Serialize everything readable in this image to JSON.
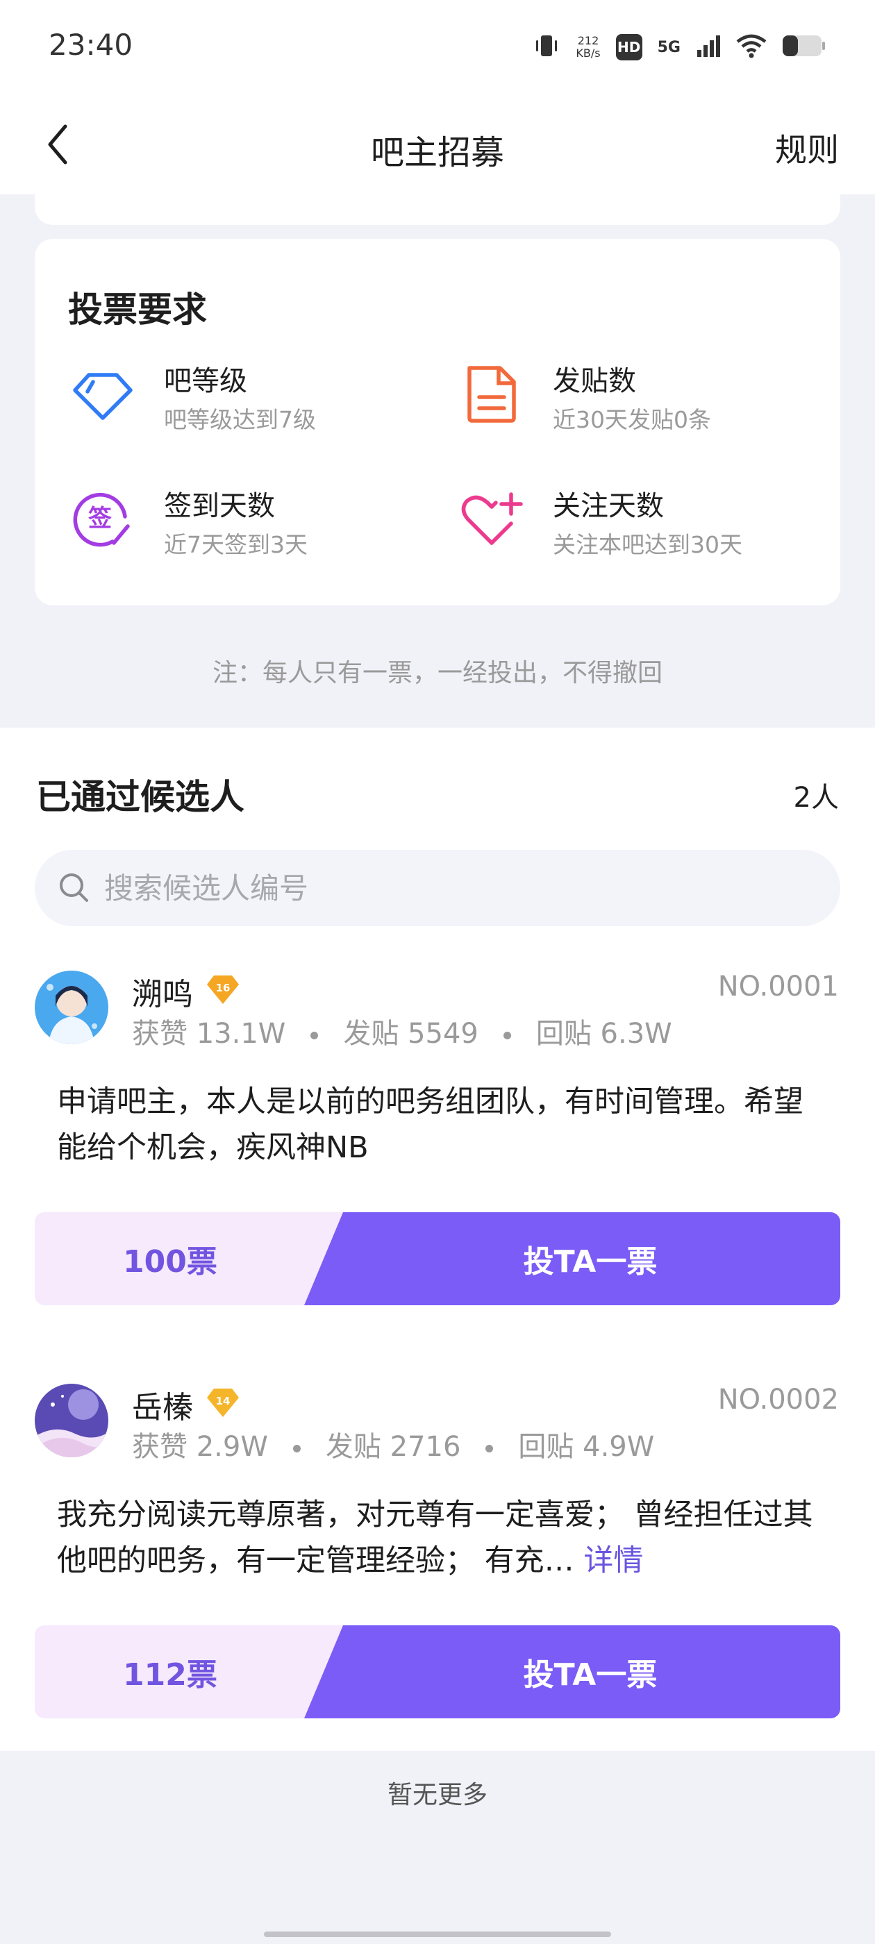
{
  "status_bar": {
    "time": "23:40",
    "net_speed_value": "212",
    "net_speed_unit": "KB/s",
    "hd_label": "HD",
    "network_label": "5G",
    "icons": [
      "vibrate-icon",
      "wifi-icon",
      "battery-icon"
    ]
  },
  "nav": {
    "title": "吧主招募",
    "rules_label": "规则",
    "back_icon": "chevron-left-icon"
  },
  "requirements": {
    "title": "投票要求",
    "items": [
      {
        "name": "吧等级",
        "desc": "吧等级达到7级",
        "icon": "diamond-icon",
        "color": "#2f7cf6"
      },
      {
        "name": "发贴数",
        "desc": "近30天发贴0条",
        "icon": "document-icon",
        "color": "#f26a3c"
      },
      {
        "name": "签到天数",
        "desc": "近7天签到3天",
        "icon": "sign-in-icon",
        "color": "#a33ce3"
      },
      {
        "name": "关注天数",
        "desc": "关注本吧达到30天",
        "icon": "heart-plus-icon",
        "color": "#ec3b8e"
      }
    ],
    "note": "注：每人只有一票，一经投出，不得撤回"
  },
  "candidates": {
    "heading": "已通过候选人",
    "count": "2人",
    "search_placeholder": "搜索候选人编号",
    "list": [
      {
        "name": "溯鸣",
        "level": "16",
        "number": "NO.0001",
        "likes": "获赞 13.1W",
        "posts": "发贴 5549",
        "replies": "回贴 6.3W",
        "description": "申请吧主，本人是以前的吧务组团队，有时间管理。希望能给个机会，疾风神NB",
        "detail_label": "",
        "votes": "100票",
        "vote_button": "投TA一票"
      },
      {
        "name": "岳榛",
        "level": "14",
        "number": "NO.0002",
        "likes": "获赞 2.9W",
        "posts": "发贴 2716",
        "replies": "回贴 4.9W",
        "description": "我充分阅读元尊原著，对元尊有一定喜爱；  曾经担任过其他吧的吧务，有一定管理经验；  有充…",
        "detail_label": "详情",
        "votes": "112票",
        "vote_button": "投TA一票"
      }
    ]
  },
  "footer": {
    "no_more": "暂无更多"
  },
  "colors": {
    "accent": "#7155e0",
    "vote_button": "#7b5cf6",
    "vote_count_bg": "#f6eafc",
    "page_bg": "#f1f1f8"
  }
}
